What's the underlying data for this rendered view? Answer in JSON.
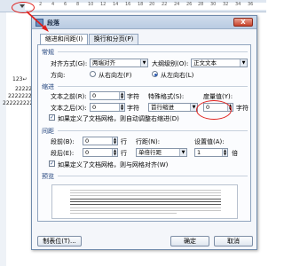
{
  "ruler": {
    "ticks": [
      "2",
      "4",
      "6",
      "8",
      "10",
      "12",
      "14",
      "16",
      "18",
      "20",
      "22",
      "24",
      "26",
      "28",
      "30",
      "32",
      "34",
      "36"
    ]
  },
  "document": {
    "lines": [
      "123↵",
      "2222222",
      "22222222",
      "222222222222"
    ]
  },
  "dialog": {
    "title": "段落",
    "close_label": "X",
    "tabs": [
      {
        "label": "缩进和间距(I)",
        "active": true
      },
      {
        "label": "换行和分页(P)",
        "active": false
      }
    ],
    "general": {
      "section_title": "常规",
      "align_label": "对齐方式(G):",
      "align_value": "两端对齐",
      "outline_label": "大纲级别(O):",
      "outline_value": "正文文本",
      "direction_label": "方向:",
      "rtl_label": "从右向左(F)",
      "ltr_label": "从左向右(L)"
    },
    "indent": {
      "section_title": "缩进",
      "before_label": "文本之前(R):",
      "before_value": "0",
      "before_unit": "字符",
      "after_label": "文本之后(X):",
      "after_value": "0",
      "after_unit": "字符",
      "special_label": "特殊格式(S):",
      "special_value": "首行缩进",
      "measure_label": "度量值(Y):",
      "measure_value": "0",
      "measure_unit": "字符",
      "grid_check_label": "如果定义了文档网格，则自动调整右缩进(D)"
    },
    "spacing": {
      "section_title": "间距",
      "before_label": "段前(B):",
      "before_value": "0",
      "before_unit": "行",
      "after_label": "段后(E):",
      "after_value": "0",
      "after_unit": "行",
      "line_label": "行距(N):",
      "line_value": "单倍行距",
      "set_label": "设置值(A):",
      "set_value": "1",
      "set_unit": "倍",
      "grid_check_label": "如果定义了文档网格，则与网格对齐(W)"
    },
    "preview": {
      "section_title": "预览"
    },
    "buttons": {
      "tabs": "制表位(T)...",
      "ok": "确定",
      "cancel": "取消"
    }
  },
  "colors": {
    "annotation": "#e0201c",
    "accent": "#2a5ab4"
  }
}
